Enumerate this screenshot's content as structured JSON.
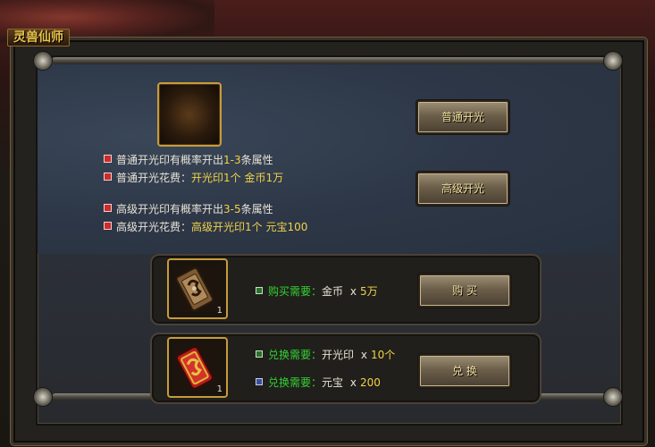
{
  "window": {
    "title": "灵兽仙师"
  },
  "buttons": {
    "normal_open": "普通开光",
    "advanced_open": "高级开光",
    "buy": "购 买",
    "exchange": "兑 换"
  },
  "info": {
    "normal_prob_prefix": "普通开光印有概率开出",
    "normal_prob_range": "1-3",
    "normal_prob_suffix": "条属性",
    "normal_cost_label": "普通开光花费：",
    "normal_cost_value": "开光印1个 金币1万",
    "adv_prob_prefix": "高级开光印有概率开出",
    "adv_prob_range": "3-5",
    "adv_prob_suffix": "条属性",
    "adv_cost_label": "高级开光花费：",
    "adv_cost_value": "高级开光印1个 元宝100"
  },
  "purchase": {
    "item_count": "1",
    "label": "购买需要：",
    "currency": "金币",
    "times": "x",
    "amount": "5万"
  },
  "exchange": {
    "item_count": "1",
    "req1_label": "兑换需要：",
    "req1_item": "开光印",
    "req1_times": "x",
    "req1_amount": "10个",
    "req2_label": "兑换需要：",
    "req2_item": "元宝",
    "req2_times": "x",
    "req2_amount": "200"
  },
  "colors": {
    "accent_gold": "#f1d248",
    "requirement_green": "#33d033",
    "bullet_red": "#d02a2a"
  }
}
